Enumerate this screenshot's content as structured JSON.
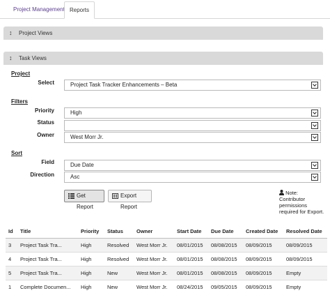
{
  "tabs": [
    {
      "label": "Project Management",
      "active": false
    },
    {
      "label": "Reports",
      "active": true
    }
  ],
  "panels": {
    "project_views": {
      "arrow": "↕",
      "title": "Project Views"
    },
    "task_views": {
      "arrow": "↕",
      "title": "Task Views"
    }
  },
  "project_section": {
    "heading": "Project",
    "select_label": "Select",
    "select_value": "Project Task Tracker Enhancements – Beta"
  },
  "filters_section": {
    "heading": "Filters",
    "priority_label": "Priority",
    "priority_value": "High",
    "status_label": "Status",
    "status_value": "",
    "owner_label": "Owner",
    "owner_value": "West Morr Jr."
  },
  "sort_section": {
    "heading": "Sort",
    "field_label": "Field",
    "field_value": "Due Date",
    "direction_label": "Direction",
    "direction_value": "Asc"
  },
  "buttons": {
    "get_report": "Get Report",
    "export_report": "Export Report"
  },
  "note": {
    "line1": "Note:",
    "line2": "Contributor",
    "line3": "permissions",
    "line4": "required for Export."
  },
  "table": {
    "headers": [
      "Id",
      "Title",
      "Priority",
      "Status",
      "Owner",
      "Start Date",
      "Due Date",
      "Created Date",
      "Resolved Date"
    ],
    "rows": [
      [
        "3",
        "Project Task Tra...",
        "High",
        "Resolved",
        "West Morr Jr.",
        "08/01/2015",
        "08/08/2015",
        "08/09/2015",
        "08/09/2015"
      ],
      [
        "4",
        "Project Task Tra...",
        "High",
        "Resolved",
        "West Morr Jr.",
        "08/01/2015",
        "08/08/2015",
        "08/09/2015",
        "08/09/2015"
      ],
      [
        "5",
        "Project Task Tra...",
        "High",
        "New",
        "West Morr Jr.",
        "08/01/2015",
        "08/08/2015",
        "08/09/2015",
        "Empty"
      ],
      [
        "1",
        "Complete Documen...",
        "High",
        "New",
        "West Morr Jr.",
        "08/24/2015",
        "09/05/2015",
        "08/09/2015",
        "Empty"
      ]
    ]
  },
  "colors": {
    "tab_link": "#5b3f8c",
    "panel_header": "#d9d9d9",
    "row_alt": "#f2f2f2"
  }
}
